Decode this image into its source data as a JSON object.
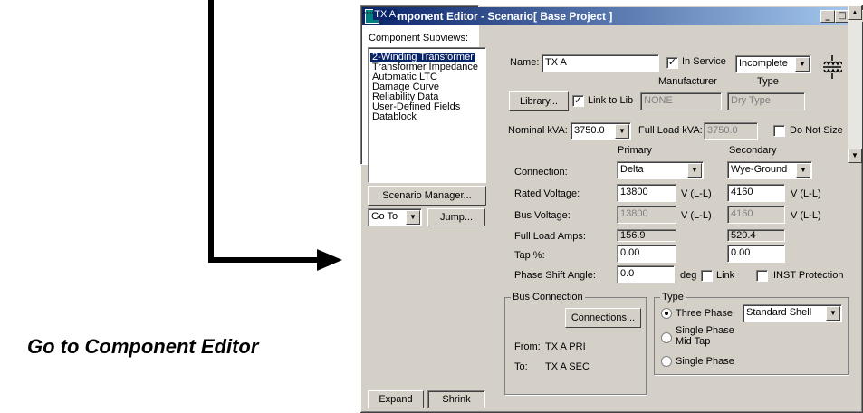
{
  "caption": "Go to Component Editor",
  "window": {
    "title": "Component Editor  - Scenario[ Base Project ]",
    "min_label": "_",
    "max_label": "□",
    "close_label": "×"
  },
  "left": {
    "subviews_label": "Component Subviews:",
    "subviews": [
      "2-Winding Transformer",
      "Transformer Impedance",
      "Automatic LTC",
      "Damage Curve",
      "Reliability Data",
      "User-Defined Fields",
      "Datablock"
    ],
    "scenario_manager_label": "Scenario Manager...",
    "goto_value": "Go To",
    "jump_label": "Jump...",
    "tree_item": "TX A",
    "expand_label": "Expand",
    "shrink_label": "Shrink"
  },
  "form": {
    "name_label": "Name:",
    "name_value": "TX A",
    "in_service_label": "In Service",
    "in_service_checked": true,
    "status_value": "Incomplete",
    "manufacturer_header": "Manufacturer",
    "type_header": "Type",
    "library_label": "Library...",
    "link_to_lib_label": "Link to Lib",
    "link_to_lib_checked": true,
    "manufacturer_value": "NONE",
    "type_value": "Dry Type",
    "nominal_kva_label": "Nominal kVA:",
    "nominal_kva_value": "3750.0",
    "full_load_kva_label": "Full Load kVA:",
    "full_load_kva_value": "3750.0",
    "do_not_size_label": "Do Not Size",
    "primary_header": "Primary",
    "secondary_header": "Secondary",
    "connection_label": "Connection:",
    "primary_connection": "Delta",
    "secondary_connection": "Wye-Ground",
    "rated_voltage_label": "Rated Voltage:",
    "primary_rated_voltage": "13800",
    "secondary_rated_voltage": "4160",
    "vll_unit": "V (L-L)",
    "bus_voltage_label": "Bus Voltage:",
    "primary_bus_voltage": "13800",
    "secondary_bus_voltage": "4160",
    "full_load_amps_label": "Full Load Amps:",
    "primary_full_load_amps": "156.9",
    "secondary_full_load_amps": "520.4",
    "tap_label": "Tap %:",
    "primary_tap": "0.00",
    "secondary_tap": "0.00",
    "phase_shift_label": "Phase Shift Angle:",
    "phase_shift_value": "0.0",
    "deg_label": "deg",
    "link_label": "Link",
    "inst_protection_label": "INST Protection"
  },
  "bus_connection": {
    "group_title": "Bus Connection",
    "connections_label": "Connections...",
    "from_label": "From:",
    "from_value": "TX A PRI",
    "to_label": "To:",
    "to_value": "TX A SEC"
  },
  "type_group": {
    "group_title": "Type",
    "three_phase_label": "Three Phase",
    "shell_value": "Standard Shell",
    "single_phase_mid_tap_line1": "Single Phase",
    "single_phase_mid_tap_line2": "Mid Tap",
    "single_phase_label": "Single Phase",
    "selected": "Three Phase"
  },
  "icons": {
    "transformer": "transformer-symbol-icon",
    "dropdown": "chevron-down-icon",
    "scroll_up": "scroll-up-icon",
    "scroll_down": "scroll-down-icon"
  }
}
